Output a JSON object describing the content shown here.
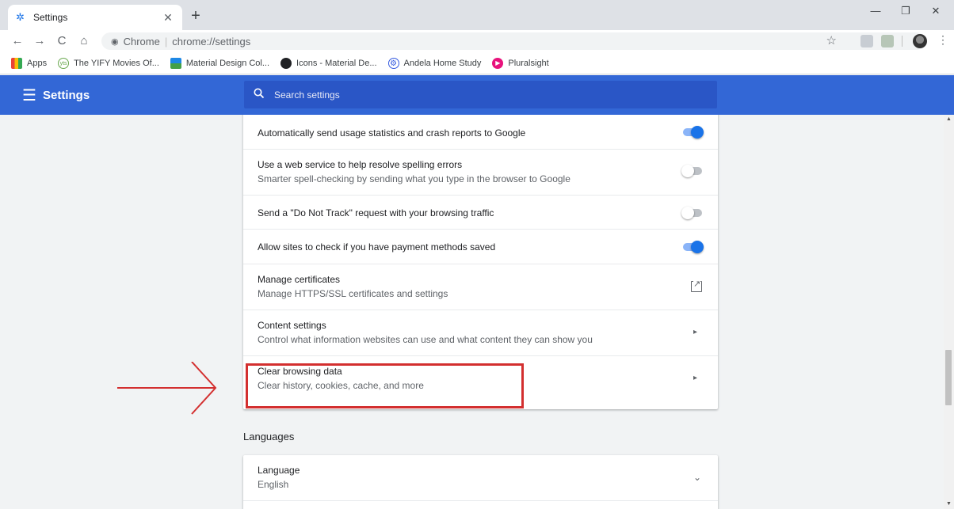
{
  "tab": {
    "title": "Settings",
    "favicon": "gear-icon"
  },
  "toolbar": {
    "site_chip": "Chrome",
    "url": "chrome://settings"
  },
  "bookmarks": [
    {
      "label": "Apps",
      "icon": "apps-grid-icon",
      "color": "#ea4335"
    },
    {
      "label": "The YIFY Movies Of...",
      "icon": "yify-icon",
      "color": "#6aa84f"
    },
    {
      "label": "Material Design Col...",
      "icon": "material-palette-icon",
      "color": "#1e88e5"
    },
    {
      "label": "Icons - Material De...",
      "icon": "material-icons-icon",
      "color": "#202124"
    },
    {
      "label": "Andela Home Study",
      "icon": "andela-icon",
      "color": "#3359df"
    },
    {
      "label": "Pluralsight",
      "icon": "pluralsight-icon",
      "color": "#e8127c"
    }
  ],
  "header": {
    "title": "Settings",
    "search_placeholder": "Search settings"
  },
  "settings_rows": [
    {
      "title": "Automatically send usage statistics and crash reports to Google",
      "subtitle": "",
      "control": "toggle",
      "state": "on"
    },
    {
      "title": "Use a web service to help resolve spelling errors",
      "subtitle": "Smarter spell-checking by sending what you type in the browser to Google",
      "control": "toggle",
      "state": "off"
    },
    {
      "title": "Send a \"Do Not Track\" request with your browsing traffic",
      "subtitle": "",
      "control": "toggle",
      "state": "off"
    },
    {
      "title": "Allow sites to check if you have payment methods saved",
      "subtitle": "",
      "control": "toggle",
      "state": "on"
    },
    {
      "title": "Manage certificates",
      "subtitle": "Manage HTTPS/SSL certificates and settings",
      "control": "external-link",
      "state": ""
    },
    {
      "title": "Content settings",
      "subtitle": "Control what information websites can use and what content they can show you",
      "control": "arrow",
      "state": ""
    },
    {
      "title": "Clear browsing data",
      "subtitle": "Clear history, cookies, cache, and more",
      "control": "arrow",
      "state": ""
    }
  ],
  "languages": {
    "section_title": "Languages",
    "row_title": "Language",
    "row_value": "English"
  },
  "colors": {
    "header_blue": "#3367d6",
    "toggle_on": "#1a73e8",
    "annotation_red": "#d32f2f"
  }
}
